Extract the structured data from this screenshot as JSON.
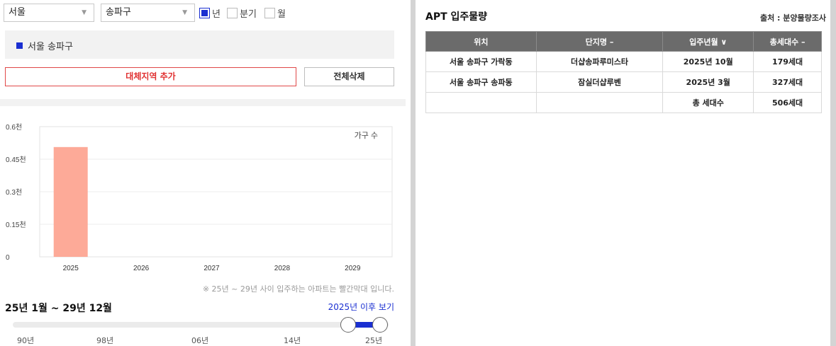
{
  "filters": {
    "city": "서울",
    "district": "송파구",
    "periods": [
      {
        "label": "년",
        "checked": true
      },
      {
        "label": "분기",
        "checked": false
      },
      {
        "label": "월",
        "checked": false
      }
    ]
  },
  "region_chip": "서울 송파구",
  "buttons": {
    "add_region": "대체지역 추가",
    "delete_all": "전체삭제"
  },
  "chart_data": {
    "type": "bar",
    "categories": [
      "2025",
      "2026",
      "2027",
      "2028",
      "2029"
    ],
    "values": [
      506,
      0,
      0,
      0,
      0
    ],
    "ylabel": "",
    "xlabel": "",
    "ytick_labels": [
      "0",
      "0.15천",
      "0.3천",
      "0.45천",
      "0.6천"
    ],
    "ylim": [
      0,
      600
    ],
    "legend_text": "가구 수",
    "bar_color": "#fdaa98",
    "grid": true
  },
  "footnote": "※ 25년 ~ 29년 사이 입주하는 아파트는 빨간막대 입니다.",
  "range_label": "25년 1월 ~ 29년 12월",
  "after_link": "2025년 이후 보기",
  "slider": {
    "ticks": [
      "90년",
      "98년",
      "06년",
      "14년",
      "25년"
    ]
  },
  "apt": {
    "title": "APT 입주물량",
    "source": "출처 : 분양물량조사",
    "headers": [
      "위치",
      "단지명 –",
      "입주년월 ∨",
      "총세대수 –"
    ],
    "rows": [
      [
        "서울 송파구 가락동",
        "더샵송파루미스타",
        "2025년 10월",
        "179세대"
      ],
      [
        "서울 송파구 송파동",
        "잠실더샵루벤",
        "2025년 3월",
        "327세대"
      ]
    ],
    "total_label": "총 세대수",
    "total_value": "506세대"
  },
  "colors": {
    "accent_blue": "#1a2fd1",
    "accent_red": "#e03030"
  }
}
